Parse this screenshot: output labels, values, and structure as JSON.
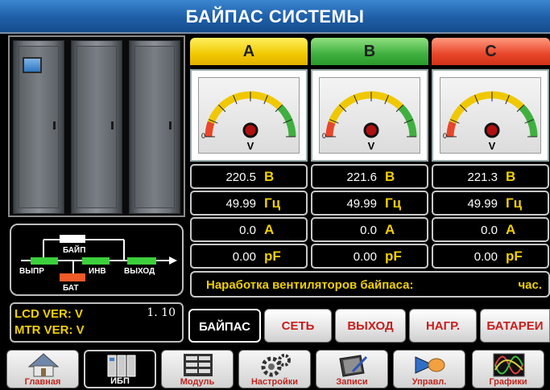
{
  "title": "БАЙПАС СИСТЕМЫ",
  "phases": [
    {
      "label": "A",
      "voltage": "220.5",
      "voltage_unit": "В",
      "frequency": "49.99",
      "frequency_unit": "Гц",
      "current": "0.0",
      "current_unit": "А",
      "pf": "0.00",
      "pf_unit": "pF",
      "gauge_zero": "0",
      "gauge_unit": "V"
    },
    {
      "label": "B",
      "voltage": "221.6",
      "voltage_unit": "В",
      "frequency": "49.99",
      "frequency_unit": "Гц",
      "current": "0.0",
      "current_unit": "А",
      "pf": "0.00",
      "pf_unit": "pF",
      "gauge_zero": "0",
      "gauge_unit": "V"
    },
    {
      "label": "C",
      "voltage": "221.3",
      "voltage_unit": "В",
      "frequency": "49.99",
      "frequency_unit": "Гц",
      "current": "0.0",
      "current_unit": "А",
      "pf": "0.00",
      "pf_unit": "pF",
      "gauge_zero": "0",
      "gauge_unit": "V"
    }
  ],
  "fan": {
    "label": "Наработка вентиляторов байпаса:",
    "unit": "час."
  },
  "flow": {
    "bypass": "БАЙП",
    "rectifier": "ВЫПР",
    "inverter": "ИНВ",
    "output": "ВЫХОД",
    "battery": "БАТ"
  },
  "version": {
    "lcd_label": "LCD VER: V",
    "lcd_value": "1.  10",
    "mtr_label": "MTR VER: V"
  },
  "tabs": [
    {
      "label": "БАЙПАС",
      "active": true
    },
    {
      "label": "СЕТЬ",
      "active": false
    },
    {
      "label": "ВЫХОД",
      "active": false
    },
    {
      "label": "НАГР.",
      "active": false
    },
    {
      "label": "БАТАРЕИ",
      "active": false
    }
  ],
  "nav": [
    {
      "label": "Главная",
      "icon": "home-icon"
    },
    {
      "label": "ИБП",
      "icon": "ups-cabinet-icon"
    },
    {
      "label": "Модуль",
      "icon": "module-icon"
    },
    {
      "label": "Настройки",
      "icon": "settings-icon"
    },
    {
      "label": "Записи",
      "icon": "records-icon"
    },
    {
      "label": "Управл.",
      "icon": "control-icon"
    },
    {
      "label": "Графики",
      "icon": "graph-icon"
    }
  ],
  "colors": {
    "accent_yellow": "#f0d000",
    "phase_a": "#f0c800",
    "phase_b": "#3fb03f",
    "phase_c": "#e8462a",
    "nav_label": "#c0251e"
  }
}
